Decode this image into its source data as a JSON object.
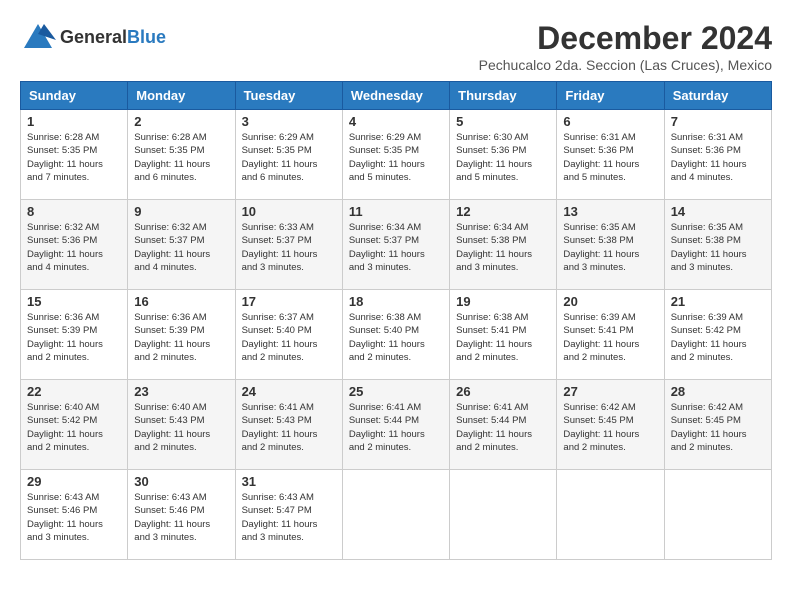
{
  "header": {
    "logo_general": "General",
    "logo_blue": "Blue",
    "month_title": "December 2024",
    "location": "Pechucalco 2da. Seccion (Las Cruces), Mexico"
  },
  "days_of_week": [
    "Sunday",
    "Monday",
    "Tuesday",
    "Wednesday",
    "Thursday",
    "Friday",
    "Saturday"
  ],
  "weeks": [
    [
      {
        "day": "1",
        "sunrise": "6:28 AM",
        "sunset": "5:35 PM",
        "daylight": "11 hours and 7 minutes."
      },
      {
        "day": "2",
        "sunrise": "6:28 AM",
        "sunset": "5:35 PM",
        "daylight": "11 hours and 6 minutes."
      },
      {
        "day": "3",
        "sunrise": "6:29 AM",
        "sunset": "5:35 PM",
        "daylight": "11 hours and 6 minutes."
      },
      {
        "day": "4",
        "sunrise": "6:29 AM",
        "sunset": "5:35 PM",
        "daylight": "11 hours and 5 minutes."
      },
      {
        "day": "5",
        "sunrise": "6:30 AM",
        "sunset": "5:36 PM",
        "daylight": "11 hours and 5 minutes."
      },
      {
        "day": "6",
        "sunrise": "6:31 AM",
        "sunset": "5:36 PM",
        "daylight": "11 hours and 5 minutes."
      },
      {
        "day": "7",
        "sunrise": "6:31 AM",
        "sunset": "5:36 PM",
        "daylight": "11 hours and 4 minutes."
      }
    ],
    [
      {
        "day": "8",
        "sunrise": "6:32 AM",
        "sunset": "5:36 PM",
        "daylight": "11 hours and 4 minutes."
      },
      {
        "day": "9",
        "sunrise": "6:32 AM",
        "sunset": "5:37 PM",
        "daylight": "11 hours and 4 minutes."
      },
      {
        "day": "10",
        "sunrise": "6:33 AM",
        "sunset": "5:37 PM",
        "daylight": "11 hours and 3 minutes."
      },
      {
        "day": "11",
        "sunrise": "6:34 AM",
        "sunset": "5:37 PM",
        "daylight": "11 hours and 3 minutes."
      },
      {
        "day": "12",
        "sunrise": "6:34 AM",
        "sunset": "5:38 PM",
        "daylight": "11 hours and 3 minutes."
      },
      {
        "day": "13",
        "sunrise": "6:35 AM",
        "sunset": "5:38 PM",
        "daylight": "11 hours and 3 minutes."
      },
      {
        "day": "14",
        "sunrise": "6:35 AM",
        "sunset": "5:38 PM",
        "daylight": "11 hours and 3 minutes."
      }
    ],
    [
      {
        "day": "15",
        "sunrise": "6:36 AM",
        "sunset": "5:39 PM",
        "daylight": "11 hours and 2 minutes."
      },
      {
        "day": "16",
        "sunrise": "6:36 AM",
        "sunset": "5:39 PM",
        "daylight": "11 hours and 2 minutes."
      },
      {
        "day": "17",
        "sunrise": "6:37 AM",
        "sunset": "5:40 PM",
        "daylight": "11 hours and 2 minutes."
      },
      {
        "day": "18",
        "sunrise": "6:38 AM",
        "sunset": "5:40 PM",
        "daylight": "11 hours and 2 minutes."
      },
      {
        "day": "19",
        "sunrise": "6:38 AM",
        "sunset": "5:41 PM",
        "daylight": "11 hours and 2 minutes."
      },
      {
        "day": "20",
        "sunrise": "6:39 AM",
        "sunset": "5:41 PM",
        "daylight": "11 hours and 2 minutes."
      },
      {
        "day": "21",
        "sunrise": "6:39 AM",
        "sunset": "5:42 PM",
        "daylight": "11 hours and 2 minutes."
      }
    ],
    [
      {
        "day": "22",
        "sunrise": "6:40 AM",
        "sunset": "5:42 PM",
        "daylight": "11 hours and 2 minutes."
      },
      {
        "day": "23",
        "sunrise": "6:40 AM",
        "sunset": "5:43 PM",
        "daylight": "11 hours and 2 minutes."
      },
      {
        "day": "24",
        "sunrise": "6:41 AM",
        "sunset": "5:43 PM",
        "daylight": "11 hours and 2 minutes."
      },
      {
        "day": "25",
        "sunrise": "6:41 AM",
        "sunset": "5:44 PM",
        "daylight": "11 hours and 2 minutes."
      },
      {
        "day": "26",
        "sunrise": "6:41 AM",
        "sunset": "5:44 PM",
        "daylight": "11 hours and 2 minutes."
      },
      {
        "day": "27",
        "sunrise": "6:42 AM",
        "sunset": "5:45 PM",
        "daylight": "11 hours and 2 minutes."
      },
      {
        "day": "28",
        "sunrise": "6:42 AM",
        "sunset": "5:45 PM",
        "daylight": "11 hours and 2 minutes."
      }
    ],
    [
      {
        "day": "29",
        "sunrise": "6:43 AM",
        "sunset": "5:46 PM",
        "daylight": "11 hours and 3 minutes."
      },
      {
        "day": "30",
        "sunrise": "6:43 AM",
        "sunset": "5:46 PM",
        "daylight": "11 hours and 3 minutes."
      },
      {
        "day": "31",
        "sunrise": "6:43 AM",
        "sunset": "5:47 PM",
        "daylight": "11 hours and 3 minutes."
      },
      null,
      null,
      null,
      null
    ]
  ],
  "labels": {
    "sunrise": "Sunrise: ",
    "sunset": "Sunset: ",
    "daylight": "Daylight: "
  }
}
